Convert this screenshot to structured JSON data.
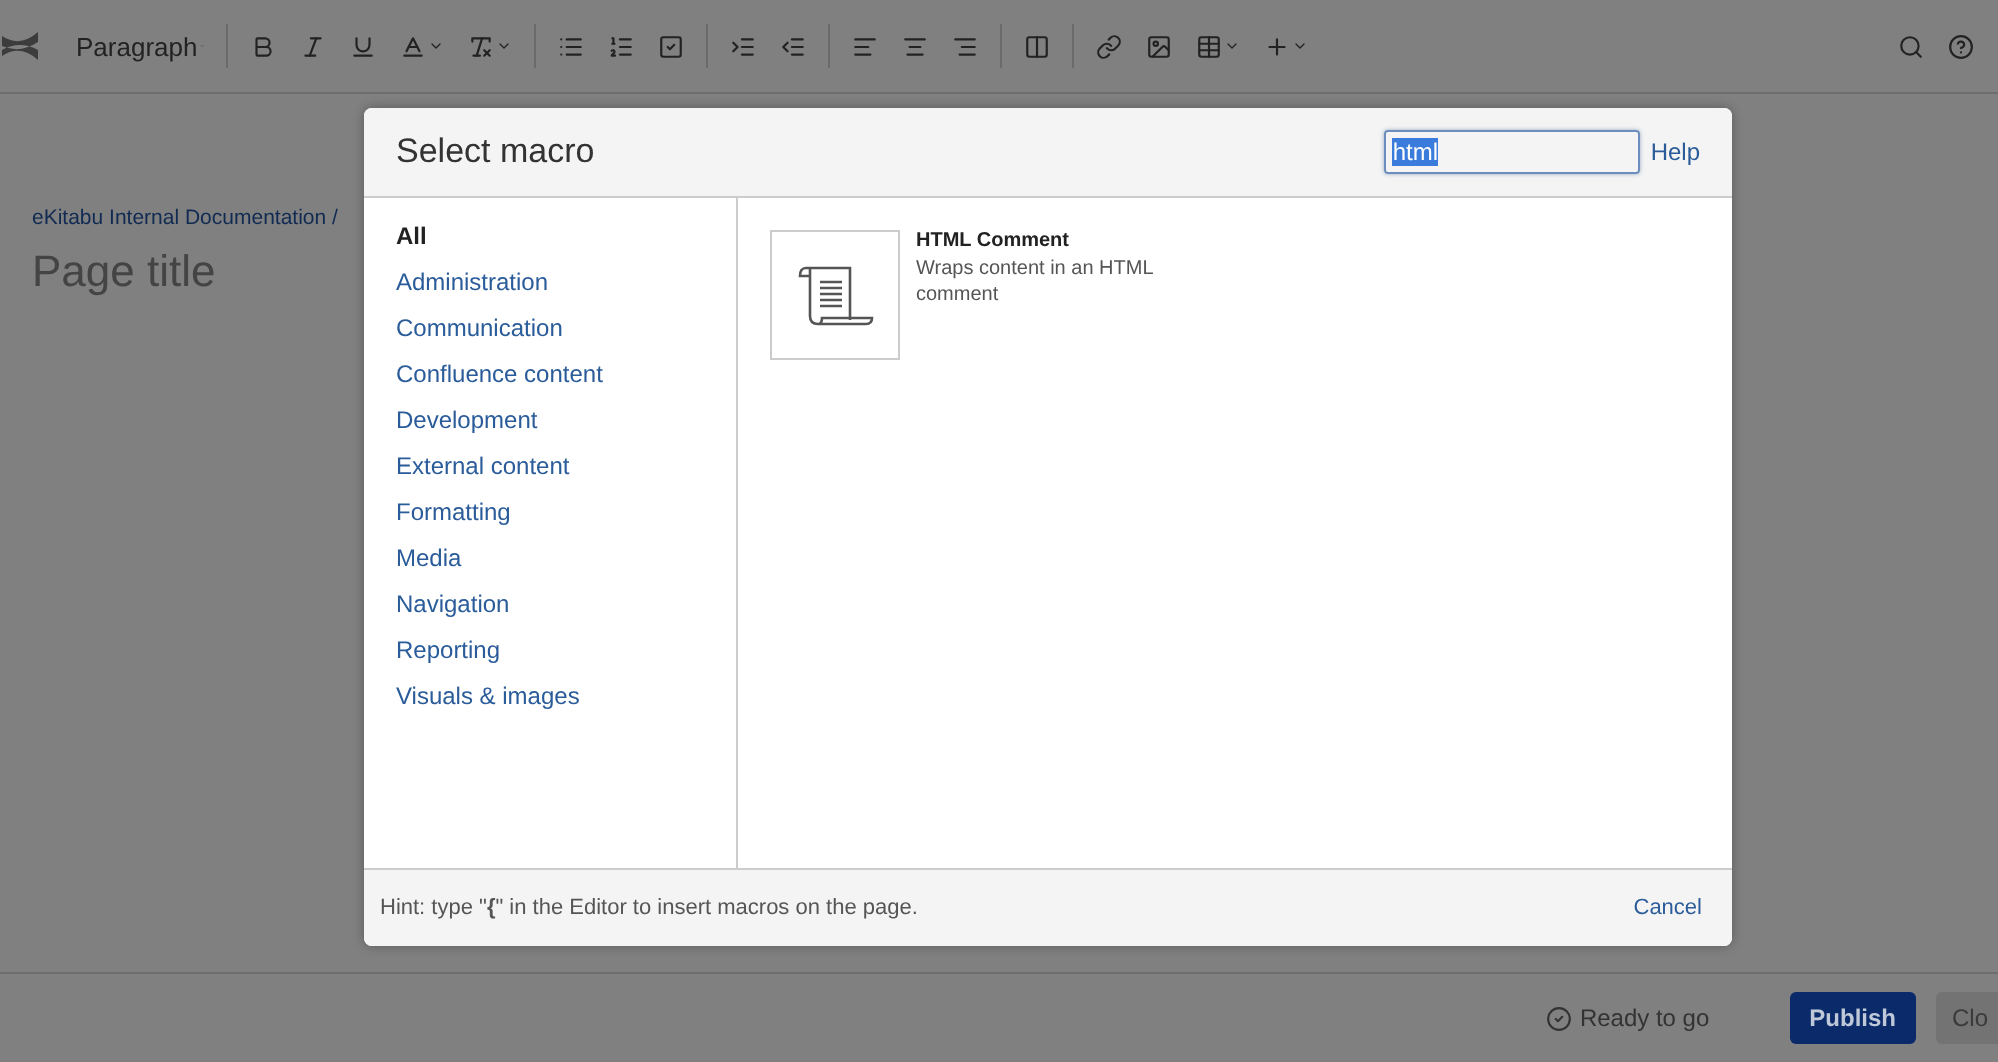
{
  "toolbar": {
    "style_dropdown": "Paragraph"
  },
  "breadcrumb": "eKitabu Internal Documentation /",
  "page_title_placeholder": "Page title",
  "dialog": {
    "title": "Select macro",
    "search": {
      "value": "html",
      "text_selected": true
    },
    "help_link": "Help",
    "categories": [
      {
        "label": "All",
        "selected": true
      },
      {
        "label": "Administration",
        "selected": false
      },
      {
        "label": "Communication",
        "selected": false
      },
      {
        "label": "Confluence content",
        "selected": false
      },
      {
        "label": "Development",
        "selected": false
      },
      {
        "label": "External content",
        "selected": false
      },
      {
        "label": "Formatting",
        "selected": false
      },
      {
        "label": "Media",
        "selected": false
      },
      {
        "label": "Navigation",
        "selected": false
      },
      {
        "label": "Reporting",
        "selected": false
      },
      {
        "label": "Visuals & images",
        "selected": false
      }
    ],
    "macros": [
      {
        "name": "HTML Comment",
        "description": "Wraps content in an HTML comment"
      }
    ],
    "hint": "Hint: type \"**{**\" in the Editor to insert macros on the page.",
    "cancel": "Cancel"
  },
  "footer": {
    "status": "Ready to go",
    "publish": "Publish",
    "close": "Clo"
  }
}
